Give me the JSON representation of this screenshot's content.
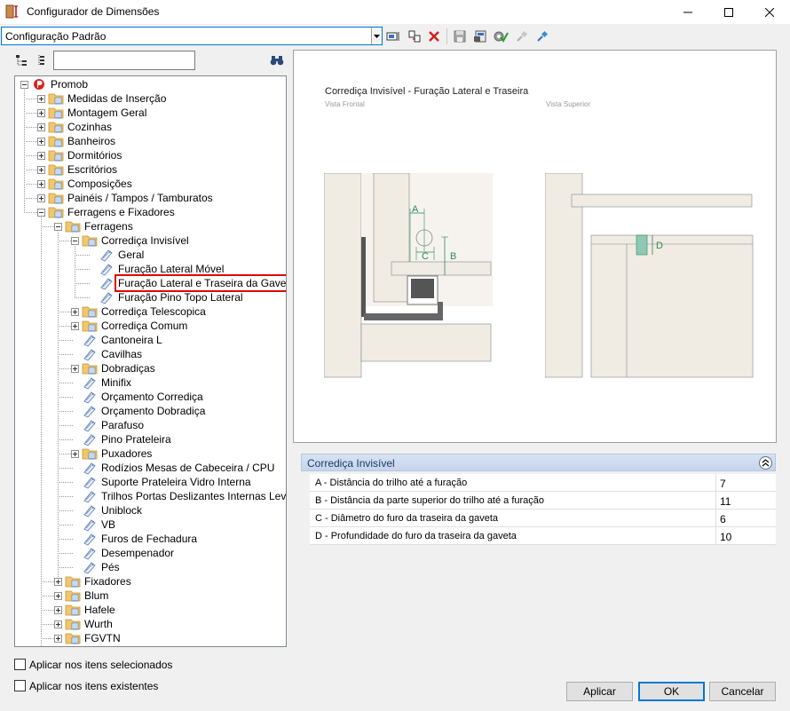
{
  "window": {
    "title": "Configurador de Dimensões"
  },
  "toolbar": {
    "config_value": "Configuração Padrão"
  },
  "search": {
    "value": "",
    "placeholder": ""
  },
  "tree": {
    "root": "Promob",
    "l1": [
      "Medidas de Inserção",
      "Montagem Geral",
      "Cozinhas",
      "Banheiros",
      "Dormitórios",
      "Escritórios",
      "Composições",
      "Painéis / Tampos / Tamburatos",
      "Ferragens e Fixadores"
    ],
    "ferragens": "Ferragens",
    "corredica": "Corrediça Invisível",
    "corredica_children": [
      "Geral",
      "Furação Lateral Móvel",
      "Furação Lateral e Traseira da Gaveta",
      "Furação Pino Topo Lateral"
    ],
    "l3": [
      "Corrediça Telescopica",
      "Corrediça Comum",
      "Cantoneira L",
      "Cavilhas",
      "Dobradiças",
      "Minifix",
      "Orçamento Corrediça",
      "Orçamento Dobradiça",
      "Parafuso",
      "Pino Prateleira",
      "Puxadores",
      "Rodízios Mesas de Cabeceira / CPU",
      "Suporte Prateleira Vidro Interna",
      "Trilhos Portas Deslizantes Internas Leves",
      "Uniblock",
      "VB",
      "Furos de Fechadura",
      "Desempenador",
      "Pés"
    ],
    "l2": [
      "Fixadores",
      "Blum",
      "Hafele",
      "Wurth",
      "FGVTN"
    ]
  },
  "preview": {
    "title": "Corrediça Invisível - Furação Lateral e Traseira",
    "front_label": "Vista Frontal",
    "top_label": "Vista Superior",
    "dim_a": "A",
    "dim_b": "B",
    "dim_c": "C",
    "dim_d": "D"
  },
  "props": {
    "header": "Corrediça Invisível",
    "rows": [
      {
        "name": "A - Distância do trilho até a furação",
        "value": "7"
      },
      {
        "name": "B - Distância da parte superior do trilho até a furação",
        "value": "11"
      },
      {
        "name": "C - Diâmetro do furo da traseira da gaveta",
        "value": "6"
      },
      {
        "name": "D - Profundidade do furo da traseira da gaveta",
        "value": "10"
      }
    ]
  },
  "options": {
    "apply_selected": "Aplicar nos itens selecionados",
    "apply_existing": "Aplicar nos itens existentes"
  },
  "buttons": {
    "apply": "Aplicar",
    "ok": "OK",
    "cancel": "Cancelar"
  },
  "colors": {
    "accent": "#0078d7",
    "selection_outline": "#e00000",
    "folder": "#f2c66a",
    "drawing_fill": "#f0ebe3",
    "dimension": "#2e8b57"
  }
}
